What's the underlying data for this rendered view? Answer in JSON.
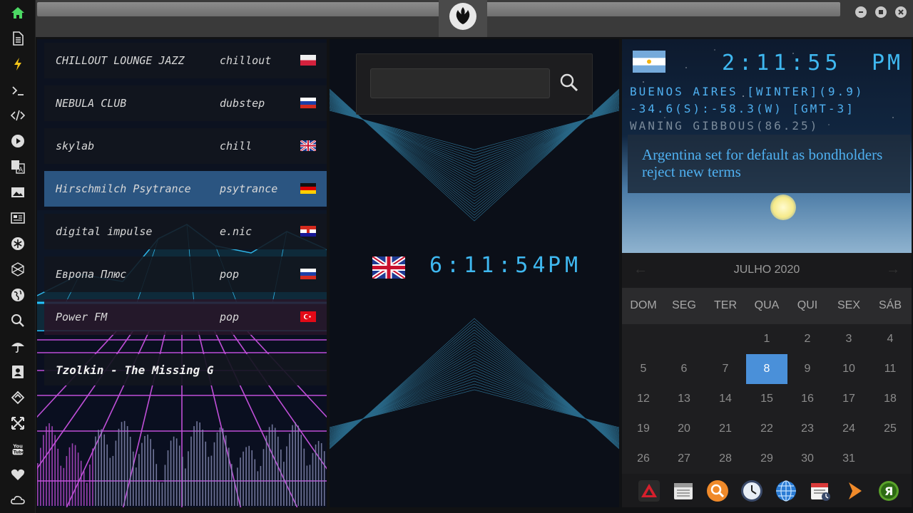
{
  "sidebar": {
    "icons": [
      "home-icon",
      "document-icon",
      "lightning-icon",
      "terminal-icon",
      "code-icon",
      "play-icon",
      "translate-icon",
      "image-icon",
      "news-icon",
      "asterisk-icon",
      "hexagon-icon",
      "globe-icon",
      "search-icon",
      "umbrella-icon",
      "contacts-icon",
      "tag-icon",
      "expand-icon",
      "youtube-icon",
      "heart-icon",
      "cloud-icon"
    ],
    "youtube_text": "You Tube"
  },
  "stations": [
    {
      "name": "CHILLOUT LOUNGE JAZZ",
      "genre": "chillout",
      "flag": "poland"
    },
    {
      "name": "NEBULA CLUB",
      "genre": "dubstep",
      "flag": "russia"
    },
    {
      "name": "skylab",
      "genre": "chill",
      "flag": "uk"
    },
    {
      "name": "Hirschmilch Psytrance",
      "genre": "psytrance",
      "flag": "germany",
      "active": true
    },
    {
      "name": "digital impulse",
      "genre": "e.nic",
      "flag": "croatia"
    },
    {
      "name": "Европа Плюс",
      "genre": "pop",
      "flag": "russia"
    },
    {
      "name": "Power FM",
      "genre": "pop",
      "flag": "turkey"
    }
  ],
  "now_playing": "Tzolkin - The Missing G",
  "center_clock": {
    "time": "6:11:54",
    "ampm": "PM",
    "flag": "uk"
  },
  "search": {
    "placeholder": ""
  },
  "world_clock": {
    "time": "2:11:55",
    "ampm": "PM",
    "line1": "BUENOS AIRES [WINTER](9.9)",
    "line2": "-34.6(S):-58.3(W) [GMT-3]",
    "line3": "WANING GIBBOUS(86.25)",
    "news": "Argentina set for default as bondholders reject new terms"
  },
  "calendar": {
    "month": "JULHO 2020",
    "prev": "←",
    "next": "→",
    "weekdays": [
      "DOM",
      "SEG",
      "TER",
      "QUA",
      "QUI",
      "SEX",
      "SÁB"
    ],
    "weeks": [
      [
        "",
        "",
        "",
        "1",
        "2",
        "3",
        "4"
      ],
      [
        "5",
        "6",
        "7",
        "8",
        "9",
        "10",
        "11"
      ],
      [
        "12",
        "13",
        "14",
        "15",
        "16",
        "17",
        "18"
      ],
      [
        "19",
        "20",
        "21",
        "22",
        "23",
        "24",
        "25"
      ],
      [
        "26",
        "27",
        "28",
        "29",
        "30",
        "31",
        ""
      ]
    ],
    "today": "8"
  },
  "dock": [
    "alert-app-icon",
    "calendar-app-icon",
    "magnifier-app-icon",
    "clock-app-icon",
    "web-globe-icon",
    "schedule-app-icon",
    "play-arrow-icon",
    "yandex-icon"
  ],
  "colors": {
    "accent": "#3fb8f0",
    "today": "#4a90d9",
    "active_station": "#4a90d9"
  }
}
